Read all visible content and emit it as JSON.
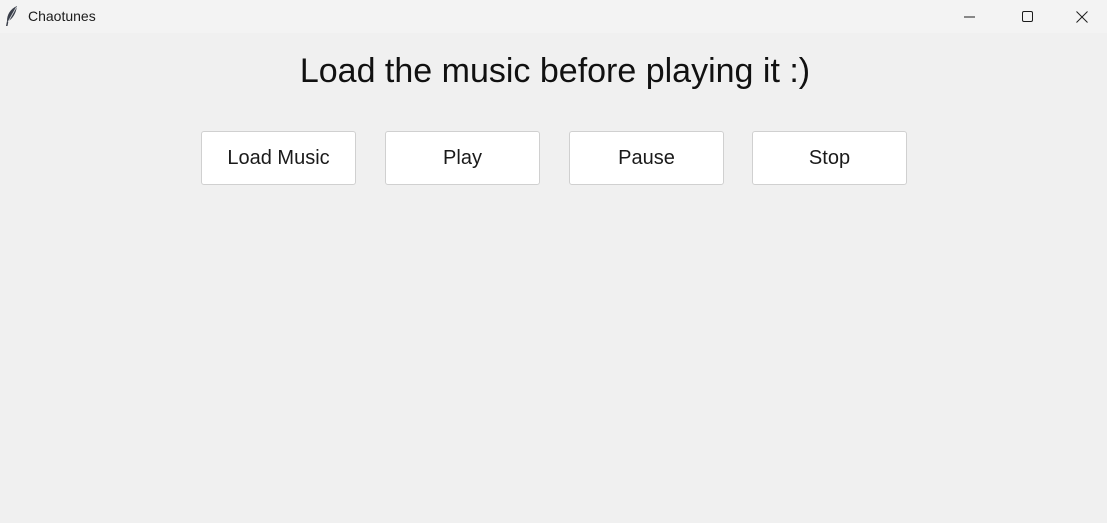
{
  "window": {
    "title": "Chaotunes",
    "app_icon": "feather-icon",
    "controls": {
      "minimize_icon": "minimize-icon",
      "maximize_icon": "maximize-icon",
      "close_icon": "close-icon"
    }
  },
  "main": {
    "heading": "Load the music before playing it :)",
    "buttons": {
      "load": "Load Music",
      "play": "Play",
      "pause": "Pause",
      "stop": "Stop"
    }
  },
  "colors": {
    "background": "#f0f0f0",
    "titlebar": "#f3f3f3",
    "button_bg": "#ffffff",
    "button_border": "#d0d0d0",
    "text": "#111111"
  }
}
